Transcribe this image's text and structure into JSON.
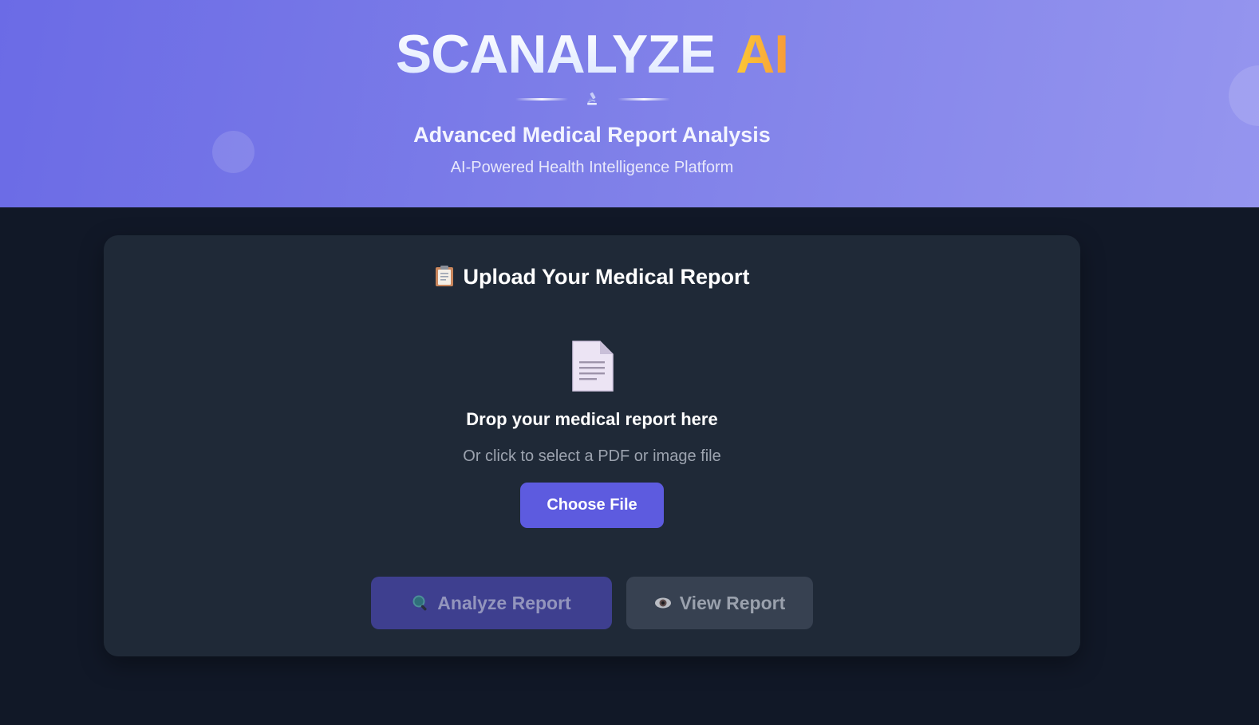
{
  "header": {
    "brand_main": "SCANALYZE",
    "brand_accent": "AI",
    "divider_icon": "microscope-icon",
    "subtitle": "Advanced Medical Report Analysis",
    "tagline": "AI-Powered Health Intelligence Platform"
  },
  "upload_card": {
    "title_icon": "clipboard-icon",
    "title": "Upload Your Medical Report",
    "drop_icon": "document-icon",
    "drop_title": "Drop your medical report here",
    "drop_hint": "Or click to select a PDF or image file",
    "choose_file_label": "Choose File"
  },
  "actions": {
    "analyze": {
      "icon": "magnifier-icon",
      "label": "Analyze Report"
    },
    "view": {
      "icon": "eye-icon",
      "label": "View Report"
    }
  },
  "colors": {
    "header_gradient_start": "#6b6be6",
    "header_gradient_end": "#9595ef",
    "page_background": "#111827",
    "card_background": "#1f2937",
    "primary_button": "#5d5bdf",
    "accent_ai_start": "#fcc935",
    "accent_ai_end": "#f79a3a",
    "disabled_analyze": "#3e3f8f",
    "disabled_view": "#374151"
  }
}
